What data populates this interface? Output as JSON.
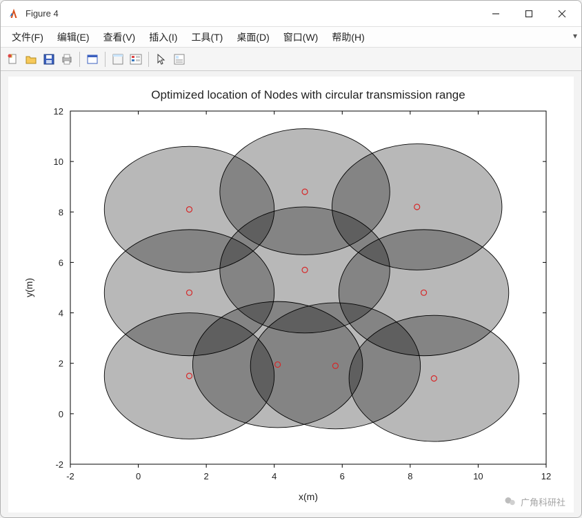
{
  "window": {
    "title": "Figure 4"
  },
  "menu": {
    "file": "文件(F)",
    "edit": "编辑(E)",
    "view": "查看(V)",
    "insert": "插入(I)",
    "tools": "工具(T)",
    "desktop": "桌面(D)",
    "window": "窗口(W)",
    "help": "帮助(H)"
  },
  "toolbar_icons": {
    "new": "new-file-icon",
    "open": "open-folder-icon",
    "save": "save-icon",
    "print": "print-icon",
    "figure": "figure-window-icon",
    "dock": "dock-icon",
    "legend": "legend-icon",
    "pointer": "pointer-icon",
    "inspect": "inspect-icon"
  },
  "watermark": {
    "text": "广角科研社"
  },
  "chart_data": {
    "type": "scatter",
    "title": "Optimized location of Nodes with circular transmission range",
    "xlabel": "x(m)",
    "ylabel": "y(m)",
    "xlim": [
      -2,
      12
    ],
    "ylim": [
      -2,
      12
    ],
    "xticks": [
      -2,
      0,
      2,
      4,
      6,
      8,
      10,
      12
    ],
    "yticks": [
      -2,
      0,
      2,
      4,
      6,
      8,
      10,
      12
    ],
    "circle_radius": 2.5,
    "nodes": [
      {
        "x": 1.5,
        "y": 8.1
      },
      {
        "x": 4.9,
        "y": 8.8
      },
      {
        "x": 8.2,
        "y": 8.2
      },
      {
        "x": 1.5,
        "y": 4.8
      },
      {
        "x": 4.9,
        "y": 5.7
      },
      {
        "x": 8.4,
        "y": 4.8
      },
      {
        "x": 1.5,
        "y": 1.5
      },
      {
        "x": 4.1,
        "y": 1.95
      },
      {
        "x": 5.8,
        "y": 1.9
      },
      {
        "x": 8.7,
        "y": 1.4
      }
    ]
  }
}
